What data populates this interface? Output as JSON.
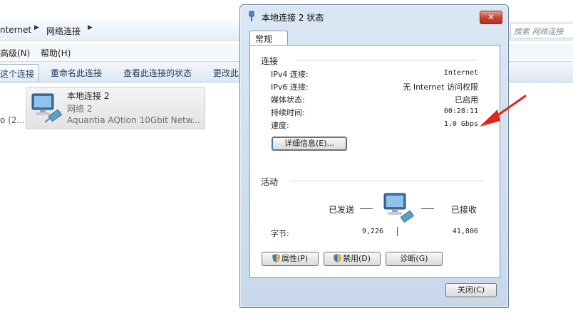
{
  "explorer": {
    "breadcrumb": [
      "nternet",
      "网络连接"
    ],
    "search_placeholder": "搜索 网络连接",
    "menu": [
      "高级(N)",
      "帮助(H)"
    ],
    "commands": [
      "这个连接",
      "重命名此连接",
      "查看此连接的状态",
      "更改此"
    ],
    "left_fragment": "o (2...",
    "connection": {
      "name": "本地连接 2",
      "network": "网络  2",
      "adapter": "Aquantia AQtion 10Gbit Netw..."
    }
  },
  "dialog": {
    "title": "本地连接 2 状态",
    "close_glyph": "✕",
    "tab": "常规",
    "connection_section": "连接",
    "rows": [
      {
        "key": "IPv4 连接:",
        "value": "Internet"
      },
      {
        "key": "IPv6 连接:",
        "value": "无 Internet 访问权限"
      },
      {
        "key": "媒体状态:",
        "value": "已启用"
      },
      {
        "key": "持续时间:",
        "value": "00:28:11"
      },
      {
        "key": "速度:",
        "value": "1.0 Gbps"
      }
    ],
    "details_button": "详细信息(E)...",
    "activity_section": "活动",
    "sent_label": "已发送",
    "received_label": "已接收",
    "bytes_label": "字节:",
    "bytes_sent": "9,226",
    "bytes_received": "41,806",
    "properties_button": "属性(P)",
    "disable_button": "禁用(D)",
    "diagnose_button": "诊断(G)",
    "close_button": "关闭(C)"
  },
  "colors": {
    "annotation_arrow": "#e0261b",
    "close_button": "#c9462d",
    "dialog_frame": "#c8d8eb"
  }
}
